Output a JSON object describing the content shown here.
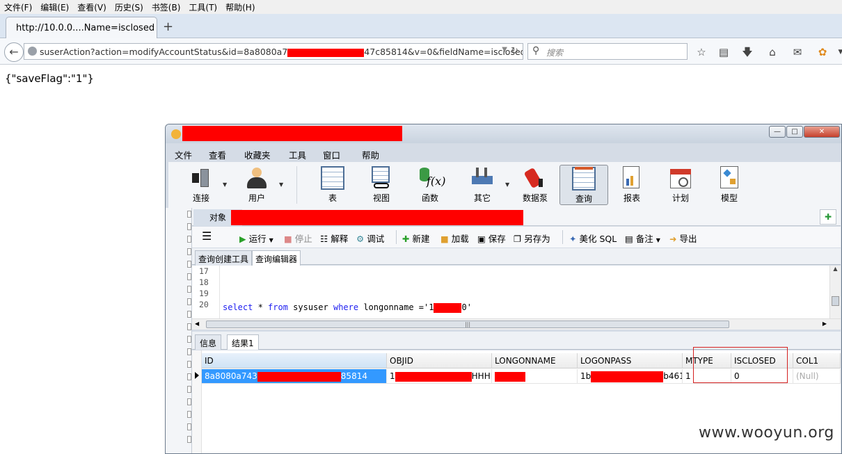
{
  "browser": {
    "menu": [
      "文件(F)",
      "编辑(E)",
      "查看(V)",
      "历史(S)",
      "书签(B)",
      "工具(T)",
      "帮助(H)"
    ],
    "tab_title": "http://10.0.0....Name=isclosed",
    "new_tab": "+",
    "url_left": "suserAction?action=modifyAccountStatus&id=8a8080a7",
    "url_right": "47c85814&v=0&fieldName=isclosed",
    "search_placeholder": "搜索"
  },
  "page": {
    "response": "{\"saveFlag\":\"1\"}"
  },
  "navicat": {
    "window_title": "",
    "menu": [
      "文件",
      "查看",
      "收藏夹",
      "工具",
      "窗口",
      "帮助"
    ],
    "toolbar": [
      {
        "label": "连接",
        "icon": "connection-icon"
      },
      {
        "label": "用户",
        "icon": "user-icon"
      },
      {
        "label": "表",
        "icon": "table-icon"
      },
      {
        "label": "视图",
        "icon": "view-icon"
      },
      {
        "label": "函数",
        "icon": "function-icon"
      },
      {
        "label": "其它",
        "icon": "other-icon"
      },
      {
        "label": "数据泵",
        "icon": "data-pump-icon"
      },
      {
        "label": "查询",
        "icon": "query-icon"
      },
      {
        "label": "报表",
        "icon": "report-icon"
      },
      {
        "label": "计划",
        "icon": "schedule-icon"
      },
      {
        "label": "模型",
        "icon": "model-icon"
      }
    ],
    "object_tab": "对象",
    "query_toolbar": {
      "run": "运行",
      "stop": "停止",
      "explain": "解释",
      "debug": "调试",
      "new": "新建",
      "load": "加载",
      "save": "保存",
      "save_as": "另存为",
      "beautify": "美化 SQL",
      "note": "备注",
      "export": "导出"
    },
    "query_tabs": [
      "查询创建工具",
      "查询编辑器"
    ],
    "editor": {
      "line_numbers": [
        "17",
        "18",
        "19",
        "20"
      ],
      "sql_kw1": "select",
      "sql_mid1": " * ",
      "sql_kw2": "from",
      "sql_mid2": " sysuser ",
      "sql_kw3": "where",
      "sql_tail": " longonname ='1",
      "sql_end": "0'"
    },
    "result_tabs": [
      "信息",
      "结果1"
    ],
    "grid": {
      "columns": [
        "ID",
        "OBJID",
        "LONGONNAME",
        "LOGONPASS",
        "MTYPE",
        "ISCLOSED",
        "COL1"
      ],
      "row": {
        "id": "8a8080a743",
        "id_tail": "85814",
        "objid": "1",
        "objid_tail": "HHHH",
        "longonname": "",
        "logonpass": "1b",
        "logonpass_tail": "b461",
        "mtype": "1",
        "isclosed": "0",
        "col1": "(Null)"
      }
    }
  },
  "watermark": "www.wooyun.org"
}
